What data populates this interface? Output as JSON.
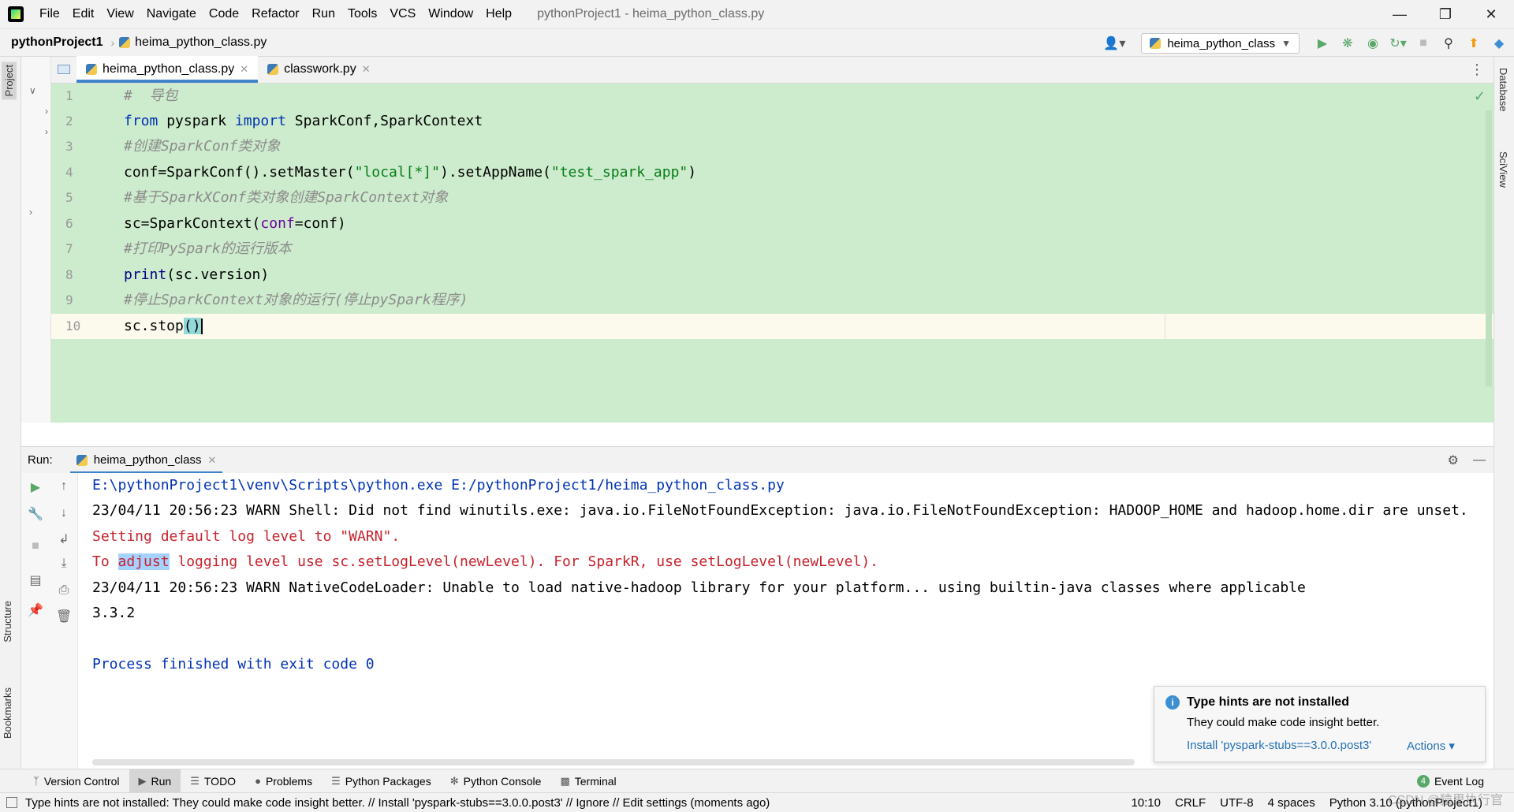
{
  "menu": {
    "items": [
      "File",
      "Edit",
      "View",
      "Navigate",
      "Code",
      "Refactor",
      "Run",
      "Tools",
      "VCS",
      "Window",
      "Help"
    ],
    "window_title": "pythonProject1 - heima_python_class.py"
  },
  "navbar": {
    "project": "pythonProject1",
    "file": "heima_python_class.py",
    "run_config": "heima_python_class"
  },
  "left_strip": {
    "project_tab": "Project",
    "structure_tab": "Structure",
    "bookmarks_tab": "Bookmarks"
  },
  "right_strip": {
    "database_tab": "Database",
    "sciview_tab": "SciView"
  },
  "editor": {
    "tabs": [
      {
        "label": "heima_python_class.py",
        "active": true
      },
      {
        "label": "classwork.py",
        "active": false
      }
    ],
    "line_numbers": [
      "1",
      "2",
      "3",
      "4",
      "5",
      "6",
      "7",
      "8",
      "9",
      "10"
    ],
    "lines": {
      "l1": "#  导包",
      "l2_kw1": "from",
      "l2_mod": " pyspark ",
      "l2_kw2": "import",
      "l2_rest": " SparkConf,SparkContext",
      "l3": "#创建SparkConf类对象",
      "l4_a": "conf=SparkConf().setMaster(",
      "l4_s1": "\"local[*]\"",
      "l4_b": ").setAppName(",
      "l4_s2": "\"test_spark_app\"",
      "l4_c": ")",
      "l5": "#基于SparkXConf类对象创建SparkContext对象",
      "l6_a": "sc=SparkContext(",
      "l6_p": "conf",
      "l6_b": "=conf)",
      "l7": "#打印PySpark的运行版本",
      "l8_fn": "print",
      "l8_rest": "(sc.version)",
      "l9": "#停止SparkContext对象的运行(停止pySpark程序)",
      "l10_a": "sc.stop",
      "l10_b": "()"
    }
  },
  "run": {
    "label": "Run:",
    "tab": "heima_python_class",
    "console": {
      "c1": "E:\\pythonProject1\\venv\\Scripts\\python.exe E:/pythonProject1/heima_python_class.py",
      "c2": "23/04/11 20:56:23 WARN Shell: Did not find winutils.exe: java.io.FileNotFoundException: java.io.FileNotFoundException: HADOOP_HOME and hadoop.home.dir are unset.",
      "c3": "Setting default log level to \"WARN\".",
      "c4_a": "To ",
      "c4_sel": "adjust",
      "c4_b": " logging level use sc.setLogLevel(newLevel). For SparkR, use setLogLevel(newLevel).",
      "c5": "23/04/11 20:56:23 WARN NativeCodeLoader: Unable to load native-hadoop library for your platform... using builtin-java classes where applicable",
      "c6": "3.3.2",
      "c7": "Process finished with exit code 0"
    }
  },
  "notification": {
    "title": "Type hints are not installed",
    "body": "They could make code insight better.",
    "link": "Install 'pyspark-stubs==3.0.0.post3'",
    "actions": "Actions ▾"
  },
  "tool_tabs": {
    "items": [
      "Version Control",
      "Run",
      "TODO",
      "Problems",
      "Python Packages",
      "Python Console",
      "Terminal"
    ],
    "event_log": "Event Log",
    "event_count": "4"
  },
  "status": {
    "message": "Type hints are not installed: They could make code insight better. // Install 'pyspark-stubs==3.0.0.post3' // Ignore // Edit settings (moments ago)",
    "position": "10:10",
    "line_sep": "CRLF",
    "encoding": "UTF-8",
    "indent": "4 spaces",
    "interpreter": "Python 3.10 (pythonProject1)",
    "watermark": "CSDN @猿思执行官"
  }
}
